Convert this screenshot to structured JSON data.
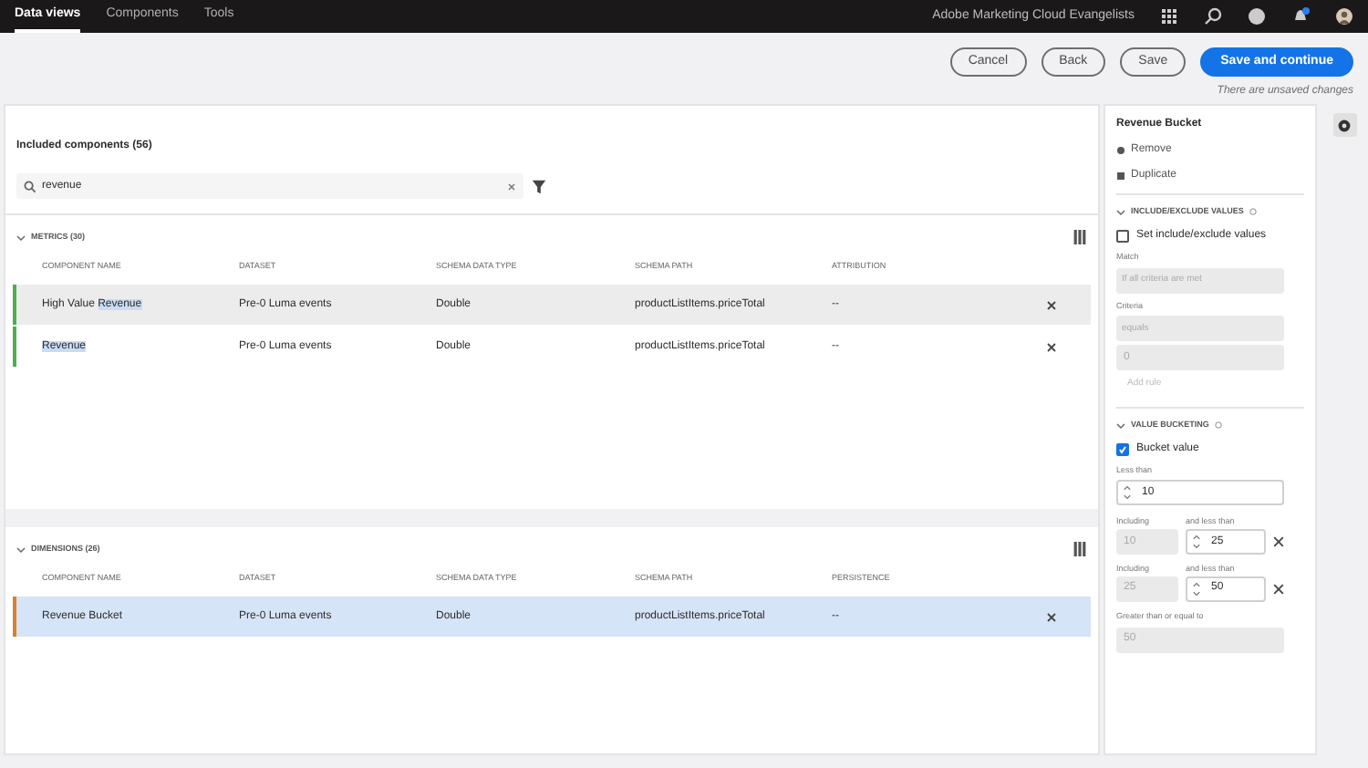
{
  "nav": {
    "tabs": [
      {
        "label": "Data views",
        "selected": true
      },
      {
        "label": "Components",
        "selected": false
      },
      {
        "label": "Tools",
        "selected": false
      }
    ],
    "org": "Adobe Marketing Cloud Evangelists"
  },
  "actions": [
    {
      "label": "Cancel",
      "kind": "secondary"
    },
    {
      "label": "Back",
      "kind": "secondary"
    },
    {
      "label": "Save",
      "kind": "secondary"
    },
    {
      "label": "Save and continue",
      "kind": "primary"
    }
  ],
  "unsaved_note": "There are unsaved changes",
  "components": {
    "title": "Included components (56)",
    "search": {
      "value": "revenue"
    },
    "sections": [
      {
        "title": "METRICS (30)",
        "expanded": true,
        "columns": [
          "COMPONENT NAME",
          "DATASET",
          "SCHEMA DATA TYPE",
          "SCHEMA PATH",
          "ATTRIBUTION"
        ],
        "rows": [
          {
            "cells": [
              [
                {
                  "text": "High Value ",
                  "highlighted": false
                },
                {
                  "text": "Revenue",
                  "highlighted": true
                }
              ],
              "Pre-0 Luma events",
              "Double",
              "productListItems.priceTotal",
              "--"
            ],
            "color": "#4caf50",
            "selected": false,
            "hovered": true
          },
          {
            "cells": [
              [
                {
                  "text": "Revenue",
                  "highlighted": true
                }
              ],
              "Pre-0 Luma events",
              "Double",
              "productListItems.priceTotal",
              "--"
            ],
            "color": "#4caf50",
            "selected": false,
            "hovered": false
          }
        ]
      },
      {
        "title": "DIMENSIONS (26)",
        "expanded": true,
        "columns": [
          "COMPONENT NAME",
          "DATASET",
          "SCHEMA DATA TYPE",
          "SCHEMA PATH",
          "PERSISTENCE"
        ],
        "rows": [
          {
            "cells": [
              [
                {
                  "text": "Revenue Bucket",
                  "highlighted": false
                }
              ],
              "Pre-0 Luma events",
              "Double",
              "productListItems.priceTotal",
              "--"
            ],
            "color": "#d9822b",
            "selected": true,
            "hovered": false
          }
        ]
      }
    ]
  },
  "settings": {
    "title": "Revenue Bucket",
    "links": [
      "Remove",
      "Duplicate"
    ],
    "include_exclude": {
      "title": "INCLUDE/EXCLUDE VALUES",
      "expanded": true,
      "checkbox": {
        "label": "Set include/exclude values",
        "checked": false
      },
      "match_label": "Match",
      "match_value": "If all criteria are met",
      "criteria_label": "Criteria",
      "criteria_value": "equals",
      "criteria_number": "0",
      "add_rule": "Add rule"
    },
    "bucketing": {
      "title": "VALUE BUCKETING",
      "expanded": true,
      "checkbox": {
        "label": "Bucket value",
        "checked": true
      },
      "less_than_label": "Less than",
      "less_than_value": "10",
      "ranges": [
        {
          "including_label": "Including",
          "including_value": "10",
          "less_label": "and less than",
          "less_value": "25"
        },
        {
          "including_label": "Including",
          "including_value": "25",
          "less_label": "and less than",
          "less_value": "50"
        }
      ],
      "greater_label": "Greater than or equal to",
      "greater_value": "50"
    }
  }
}
